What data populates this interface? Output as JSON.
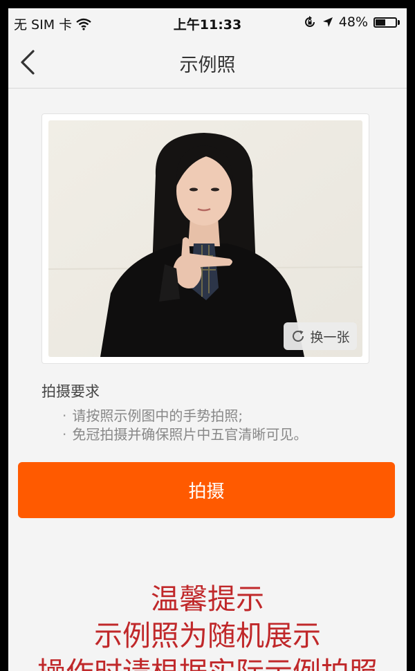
{
  "status_bar": {
    "carrier": "无 SIM 卡",
    "time": "上午11:33",
    "battery": "48%",
    "battery_level": 0.48
  },
  "nav": {
    "title": "示例照"
  },
  "photo": {
    "swap_label": "换一张"
  },
  "requirements": {
    "title": "拍摄要求",
    "items": [
      "请按照示例图中的手势拍照;",
      "免冠拍摄并确保照片中五官清晰可见。"
    ]
  },
  "capture_button": "拍摄",
  "notice": {
    "lines": [
      "温馨提示",
      "示例照为随机展示",
      "操作时请根据实际示例拍照"
    ]
  },
  "colors": {
    "accent": "#ff5a00",
    "notice_red": "#c0282a"
  },
  "icons": [
    "wifi-icon",
    "lock-rotation-icon",
    "location-arrow-icon",
    "battery-icon",
    "back-chevron-icon",
    "refresh-icon"
  ]
}
